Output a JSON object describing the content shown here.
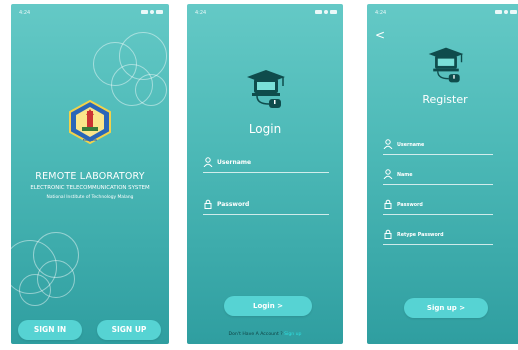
{
  "status_bar": {
    "time": "4:24"
  },
  "welcome": {
    "title": "REMOTE LABORATORY",
    "subtitle": "ELECTRONIC TELECOMMUNICATION SYSTEM",
    "institute": "National Institute of Technology Malang",
    "emblem_text": "MALANG",
    "sign_in_label": "SIGN IN",
    "sign_up_label": "SIGN UP"
  },
  "login": {
    "heading": "Login",
    "username_label": "Username",
    "password_label": "Password",
    "login_button": "Login >",
    "account_prompt": "Don't Have A Account ?",
    "sign_up_link": "Sign up"
  },
  "register": {
    "back": "<",
    "heading": "Register",
    "username_label": "Username",
    "name_label": "Name",
    "password_label": "Password",
    "retype_label": "Retype Password",
    "sign_up_button": "Sign up >"
  },
  "colors": {
    "gradient_top": "#64c9c6",
    "gradient_bottom": "#2f9ea0",
    "button": "#56d3d3",
    "link": "#2ee0e0"
  }
}
